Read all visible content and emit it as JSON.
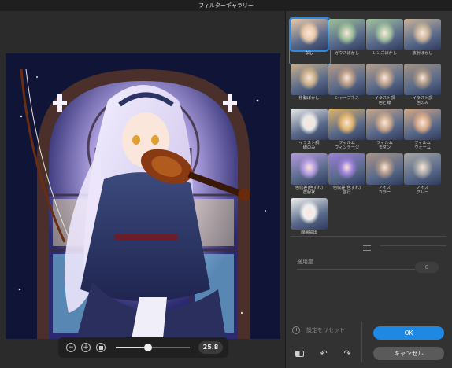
{
  "window": {
    "title": "フィルターギャラリー"
  },
  "zoom": {
    "value": "25.8",
    "slider_level": 0.44,
    "minus_icon": "zoom-out-icon",
    "plus_icon": "zoom-in-icon",
    "fit_icon": "fit-screen-icon"
  },
  "filters": [
    {
      "label": "なし",
      "tint": "#e9c9a8",
      "selected": true
    },
    {
      "label": "ガウスぼかし",
      "tint": "#9fc19a",
      "selected": false
    },
    {
      "label": "レンズぼかし",
      "tint": "#a3c2a0",
      "selected": false
    },
    {
      "label": "放射ぼかし",
      "tint": "#c8b39a",
      "selected": false
    },
    {
      "label": "移動ぼかし",
      "tint": "#c9b089",
      "selected": false
    },
    {
      "label": "シャープネス",
      "tint": "#b79a86",
      "selected": false
    },
    {
      "label": "イラスト調\n色と線",
      "tint": "#b8a08c",
      "selected": false
    },
    {
      "label": "イラスト調\n色のみ",
      "tint": "#a69483",
      "selected": false
    },
    {
      "label": "イラスト調\n線のみ",
      "tint": "#e8e8e8",
      "selected": false
    },
    {
      "label": "フィルム\nヴィンテージ",
      "tint": "#e0b46a",
      "selected": false
    },
    {
      "label": "フィルム\nモダン",
      "tint": "#caa98c",
      "selected": false
    },
    {
      "label": "フィルム\nウォーム",
      "tint": "#d6a987",
      "selected": false
    },
    {
      "label": "色収差(色ずれ)\n放射状",
      "tint": "#b59be0",
      "selected": false
    },
    {
      "label": "色収差(色ずれ)\n並行",
      "tint": "#9a7fd8",
      "selected": false
    },
    {
      "label": "ノイズ\nカラー",
      "tint": "#a99487",
      "selected": false
    },
    {
      "label": "ノイズ\nグレー",
      "tint": "#a6a6a6",
      "selected": false
    },
    {
      "label": "線画抽出",
      "tint": "#efefef",
      "selected": false
    }
  ],
  "opacity": {
    "label": "適用度",
    "value": "0"
  },
  "actions": {
    "reset_label": "設定をリセット",
    "ok_label": "OK",
    "cancel_label": "キャンセル",
    "compare_icon": "compare-icon",
    "undo_icon": "undo-icon",
    "redo_icon": "redo-icon",
    "reset_icon": "reset-icon"
  },
  "colors": {
    "accent": "#1e88e5",
    "panel": "#323232",
    "background": "#2b2b2b"
  }
}
